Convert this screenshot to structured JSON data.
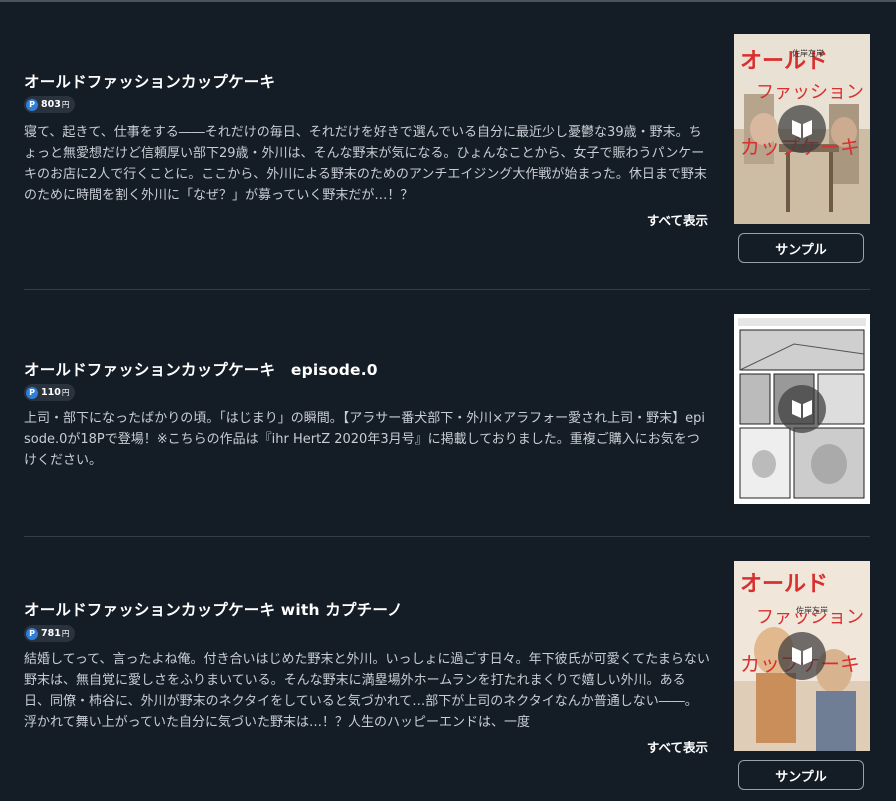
{
  "items": [
    {
      "title": "オールドファッションカップケーキ",
      "price": "803",
      "price_unit": "円",
      "description": "寝て、起きて、仕事をする――それだけの毎日、それだけを好きで選んでいる自分に最近少し憂鬱な39歳・野末。ちょっと無愛想だけど信頼厚い部下29歳・外川は、そんな野末が気になる。ひょんなことから、女子で賑わうパンケーキのお店に2人で行くことに。ここから、外川による野末のためのアンチエイジング大作戦が始まった。休日まで野末のために時間を割く外川に「なぜ？」が募っていく野末だが…！？",
      "show_all": "すべて表示",
      "sample": "サンプル",
      "cover_title": "オールドファッションカップケーキ",
      "cover_author": "佐岸左岸"
    },
    {
      "title": "オールドファッションカップケーキ　episode.0",
      "price": "110",
      "price_unit": "円",
      "description": "上司・部下になったばかりの頃。「はじまり」の瞬間。【アラサー番犬部下・外川×アラフォー愛され上司・野末】episode.0が18Pで登場！※こちらの作品は『ihr HertZ 2020年3月号』に掲載しておりました。重複ご購入にお気をつけください。"
    },
    {
      "title": "オールドファッションカップケーキ with カプチーノ",
      "price": "781",
      "price_unit": "円",
      "description": "結婚してって、言ったよね俺。付き合いはじめた野末と外川。いっしょに過ごす日々。年下彼氏が可愛くてたまらない野末は、無自覚に愛しさをふりまいている。そんな野末に満塁場外ホームランを打たれまくりで嬉しい外川。ある日、同僚・柿谷に、外川が野末のネクタイをしていると気づかれて…部下が上司のネクタイなんか普通しない――。浮かれて舞い上がっていた自分に気づいた野末は…！？人生のハッピーエンドは、一度",
      "show_all": "すべて表示",
      "sample": "サンプル",
      "cover_title": "オールドファッションカップケーキ",
      "cover_author": "佐岸左岸"
    }
  ],
  "price_icon": "P"
}
